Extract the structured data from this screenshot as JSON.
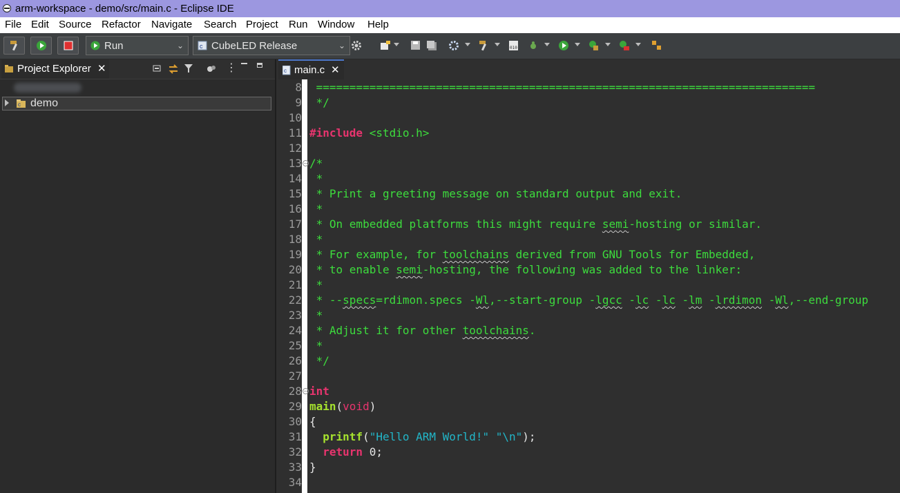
{
  "window": {
    "title": "arm-workspace - demo/src/main.c - Eclipse IDE"
  },
  "menu": [
    "File",
    "Edit",
    "Source",
    "Refactor",
    "Navigate",
    "Search",
    "Project",
    "Run",
    "Window",
    "Help"
  ],
  "toolbar": {
    "launch_mode": "Run",
    "launch_config": "CubeLED Release"
  },
  "project_explorer": {
    "tab_title": "Project Explorer",
    "items": [
      {
        "label": "demo",
        "expanded": false
      }
    ]
  },
  "editor": {
    "tab_title": "main.c",
    "lines": [
      {
        "n": "8",
        "text": " ==========================================================================="
      },
      {
        "n": "9",
        "text": " */"
      },
      {
        "n": "10",
        "text": ""
      },
      {
        "n": "11",
        "pp": "#include",
        "inc": " <stdio.h>"
      },
      {
        "n": "12",
        "text": ""
      },
      {
        "n": "13",
        "text": "/*",
        "fold": true
      },
      {
        "n": "14",
        "text": " *"
      },
      {
        "n": "15",
        "text": " * Print a greeting message on standard output and exit."
      },
      {
        "n": "16",
        "text": " *"
      },
      {
        "n": "17",
        "c1": " * On embedded platforms this might require ",
        "s1": "semi",
        "c2": "-hosting or similar."
      },
      {
        "n": "18",
        "text": " *"
      },
      {
        "n": "19",
        "c1": " * For example, for ",
        "s1": "toolchains",
        "c2": " derived from GNU Tools for Embedded,"
      },
      {
        "n": "20",
        "c1": " * to enable ",
        "s1": "semi",
        "c2": "-hosting, the following was added to the linker:"
      },
      {
        "n": "21",
        "text": " *"
      },
      {
        "n": "22",
        "c1": " * --",
        "s1": "specs",
        "c2": "=rdimon.specs -",
        "s2": "Wl",
        "c3": ",--start-group -",
        "s3": "lgcc",
        "c4": " -",
        "s4": "lc",
        "c5": " -",
        "s5": "lc",
        "c6": " -",
        "s6": "lm",
        "c7": " -",
        "s7": "lrdimon",
        "c8": " -",
        "s8": "Wl",
        "c9": ",--end-group"
      },
      {
        "n": "23",
        "text": " *"
      },
      {
        "n": "24",
        "c1": " * Adjust it for other ",
        "s1": "toolchains",
        "c2": "."
      },
      {
        "n": "25",
        "text": " *"
      },
      {
        "n": "26",
        "text": " */"
      },
      {
        "n": "27",
        "text": ""
      },
      {
        "n": "28",
        "kw": "int",
        "fold": true
      },
      {
        "n": "29",
        "fn": "main",
        "p1": "(",
        "kw": "void",
        "p2": ")"
      },
      {
        "n": "30",
        "text": "{"
      },
      {
        "n": "31",
        "ind": "  ",
        "fn": "printf",
        "p1": "(",
        "str": "\"Hello ARM World!\" \"\\n\"",
        "p2": ");"
      },
      {
        "n": "32",
        "ind": "  ",
        "kw": "return",
        "num": " 0",
        "p2": ";"
      },
      {
        "n": "33",
        "text": "}"
      },
      {
        "n": "34",
        "text": ""
      }
    ]
  }
}
